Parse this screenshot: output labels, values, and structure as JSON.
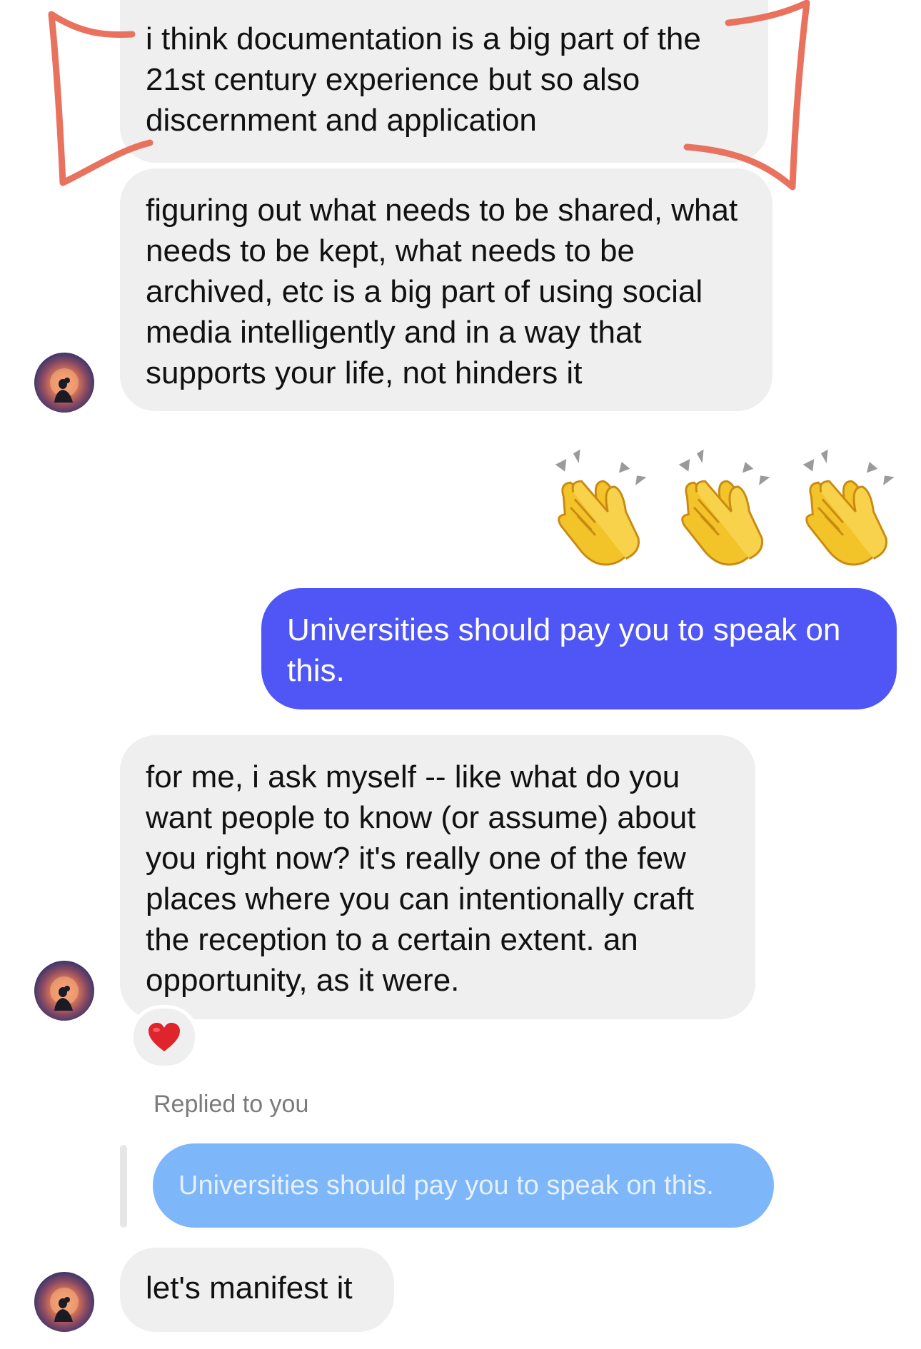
{
  "thread": {
    "messages": [
      {
        "text": "i think documentation is a big part of the 21st century experience but so also discernment and application"
      },
      {
        "text": "figuring out what needs to be shared, what needs to be kept, what needs to be archived, etc is a big part of using social media intelligently and in a way that supports your life, not hinders it"
      },
      {
        "text": "Universities should pay you to speak on this."
      },
      {
        "text": "for me, i ask myself -- like what do you want people to know (or assume) about you right now? it's really one of the few places where you can intentionally craft the reception to a certain extent. an opportunity, as it were."
      },
      {
        "text": "let's manifest it"
      }
    ],
    "clap_emojis": [
      "👏",
      "👏",
      "👏"
    ],
    "reaction_emoji": "❤️",
    "reply": {
      "label": "Replied to you",
      "quoted_text": "Universities should pay you to speak on this."
    }
  },
  "colors": {
    "incoming_bubble": "#efefef",
    "outgoing_bubble": "#4f56f5",
    "quoted_bubble": "#7db6f9",
    "annotation": "#e8725e"
  },
  "icons": {
    "avatar": "profile-avatar-icon",
    "clap": "clapping-hands-icon",
    "heart": "red-heart-icon"
  }
}
